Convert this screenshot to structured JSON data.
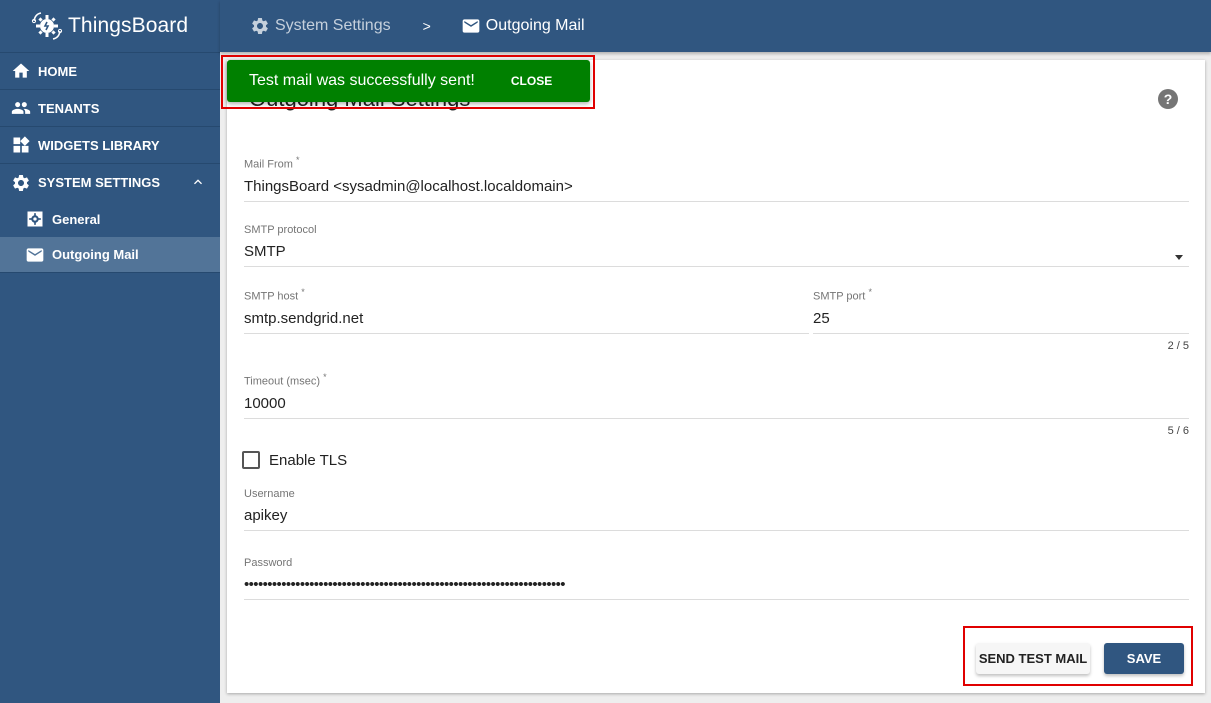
{
  "app": {
    "title": "ThingsBoard"
  },
  "sidebar": {
    "items": [
      {
        "label": "HOME",
        "icon": "home-icon"
      },
      {
        "label": "TENANTS",
        "icon": "people-icon"
      },
      {
        "label": "WIDGETS LIBRARY",
        "icon": "widgets-icon"
      },
      {
        "label": "SYSTEM SETTINGS",
        "icon": "gear-icon",
        "expanded": true,
        "children": [
          {
            "label": "General",
            "icon": "settings-box-icon"
          },
          {
            "label": "Outgoing Mail",
            "icon": "mail-icon",
            "active": true
          }
        ]
      }
    ]
  },
  "breadcrumb": {
    "items": [
      {
        "label": "System Settings",
        "icon": "gear-icon"
      },
      {
        "label": "Outgoing Mail",
        "icon": "mail-icon"
      }
    ],
    "separator": ">"
  },
  "card": {
    "title": "Outgoing Mail Settings",
    "help_icon": "?"
  },
  "form": {
    "mail_from": {
      "label": "Mail From",
      "required": "*",
      "value": "ThingsBoard <sysadmin@localhost.localdomain>"
    },
    "smtp_protocol": {
      "label": "SMTP protocol",
      "value": "SMTP"
    },
    "smtp_host": {
      "label": "SMTP host",
      "required": "*",
      "value": "smtp.sendgrid.net"
    },
    "smtp_port": {
      "label": "SMTP port",
      "required": "*",
      "value": "25",
      "hint": "2 / 5"
    },
    "timeout": {
      "label": "Timeout (msec)",
      "required": "*",
      "value": "10000",
      "hint": "5 / 6"
    },
    "enable_tls": {
      "label": "Enable TLS",
      "checked": false
    },
    "username": {
      "label": "Username",
      "value": "apikey"
    },
    "password": {
      "label": "Password",
      "value": "•••••••••••••••••••••••••••••••••••••••••••••••••••••••••••••••••••••"
    }
  },
  "buttons": {
    "send_test_mail": "SEND TEST MAIL",
    "save": "SAVE"
  },
  "toast": {
    "message": "Test mail was successfully sent!",
    "action": "CLOSE",
    "color": "#008000"
  },
  "colors": {
    "primary": "#305680",
    "sidebar_active": "#527498",
    "highlight": "#e00000"
  }
}
